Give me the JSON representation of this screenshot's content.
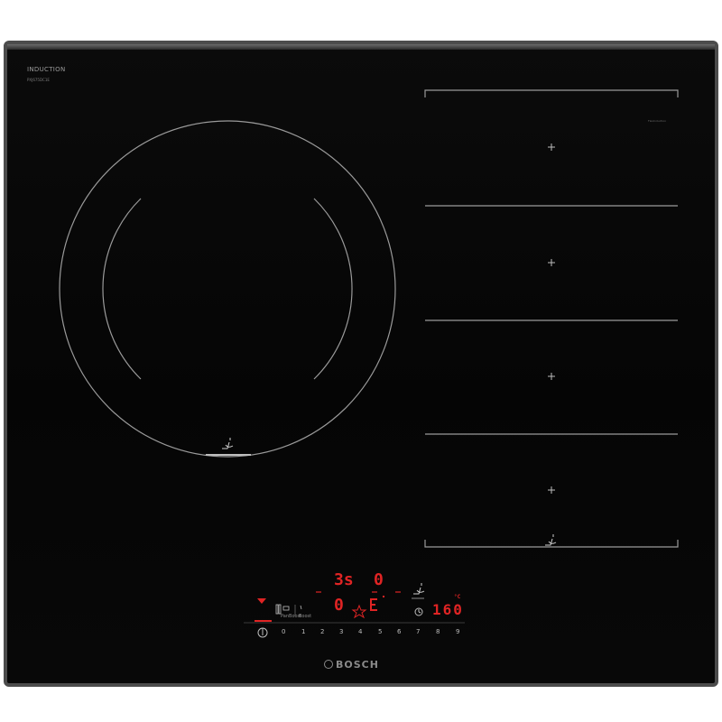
{
  "hob": {
    "series_label": "INDUCTION",
    "model_label": "PXJ675DC1E",
    "brand": "BOSCH"
  },
  "flexzone": {
    "tag": "FlexInduction"
  },
  "display": {
    "top_timer": "3s",
    "top_level": "0",
    "mid_level": "0",
    "mid_symbol": "⊏",
    "temperature": "160",
    "temp_unit": "°C"
  },
  "controls": {
    "power_symbol": "⏻",
    "scale": [
      "0",
      "1",
      "2",
      "3",
      "4",
      "5",
      "6",
      "7",
      "8",
      "9"
    ],
    "labels": {
      "pan_boost": "PanBoost",
      "boost": "Boost",
      "flex": "Flex"
    }
  },
  "colors": {
    "accent": "#e02424",
    "panel": "#060606",
    "frame": "#4c4c4c"
  },
  "icons": [
    "power-icon",
    "timer-icon",
    "pan-sensor-icon",
    "flex-icon",
    "boost-icon",
    "favorite-icon",
    "arrow-down-icon"
  ]
}
